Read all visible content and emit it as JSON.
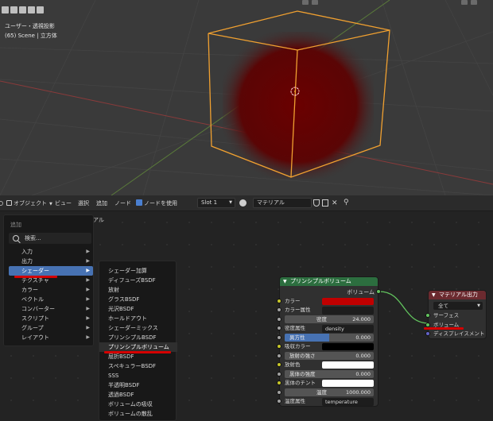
{
  "viewport": {
    "view_name": "ユーザー・透視投影",
    "object_info": "(65) Scene | 立方体"
  },
  "header": {
    "mode": "オブジェクト",
    "menus": [
      "ビュー",
      "選択",
      "追加",
      "ノード"
    ],
    "use_nodes_label": "ノードを使用",
    "slot": "Slot 1",
    "material_name": "マテリアル"
  },
  "editor": {
    "partial_label_left": "ト",
    "partial_label_right": "アル"
  },
  "add_menu": {
    "title": "追加",
    "search_placeholder": "検索...",
    "items": [
      {
        "label": "入力",
        "submenu": true
      },
      {
        "label": "出力",
        "submenu": true
      },
      {
        "label": "シェーダー",
        "submenu": true,
        "active": true
      },
      {
        "label": "テクスチャ",
        "submenu": true
      },
      {
        "label": "カラー",
        "submenu": true
      },
      {
        "label": "ベクトル",
        "submenu": true
      },
      {
        "label": "コンバーター",
        "submenu": true
      },
      {
        "label": "スクリプト",
        "submenu": true
      },
      {
        "label": "グループ",
        "submenu": true
      },
      {
        "label": "レイアウト",
        "submenu": true
      }
    ]
  },
  "shader_menu": {
    "items": [
      "シェーダー加算",
      "ディフューズBSDF",
      "放射",
      "グラスBSDF",
      "光沢BSDF",
      "ホールドアウト",
      "シェーダーミックス",
      "プリンシプルBSDF",
      "プリンシプルボリューム",
      "屈折BSDF",
      "スペキュラーBSDF",
      "SSS",
      "半透明BSDF",
      "透過BSDF",
      "ボリュームの吸収",
      "ボリュームの散乱"
    ],
    "highlighted": "プリンシプルボリューム"
  },
  "principled_volume": {
    "title": "プリンシプルボリューム",
    "output": "ボリューム",
    "color_label": "カラー",
    "color_value": "#c00000",
    "color_attr_label": "カラー属性",
    "density_label": "密度",
    "density_value": "24.000",
    "density_attr_label": "密度属性",
    "density_attr_value": "density",
    "anisotropy_label": "異方性",
    "anisotropy_value": "0.000",
    "absorption_label": "吸収カラー",
    "absorption_value": "#000000",
    "emission_strength_label": "放射の強さ",
    "emission_strength_value": "0.000",
    "emission_color_label": "放射色",
    "emission_color_value": "#ffffff",
    "blackbody_label": "黒体の強度",
    "blackbody_value": "0.000",
    "blackbody_tint_label": "黒体のチント",
    "blackbody_tint_value": "#ffffff",
    "temperature_label": "温度",
    "temperature_value": "1000.000",
    "temperature_attr_label": "温度属性",
    "temperature_attr_value": "temperature"
  },
  "material_output": {
    "title": "マテリアル出力",
    "target": "全て",
    "inputs": [
      "サーフェス",
      "ボリューム",
      "ディスプレイスメント"
    ]
  },
  "colors": {
    "shader_header": "#2c6e3f",
    "output_header": "#6b2a2f",
    "menu_active": "#4772b3",
    "annotation": "#d40000"
  }
}
